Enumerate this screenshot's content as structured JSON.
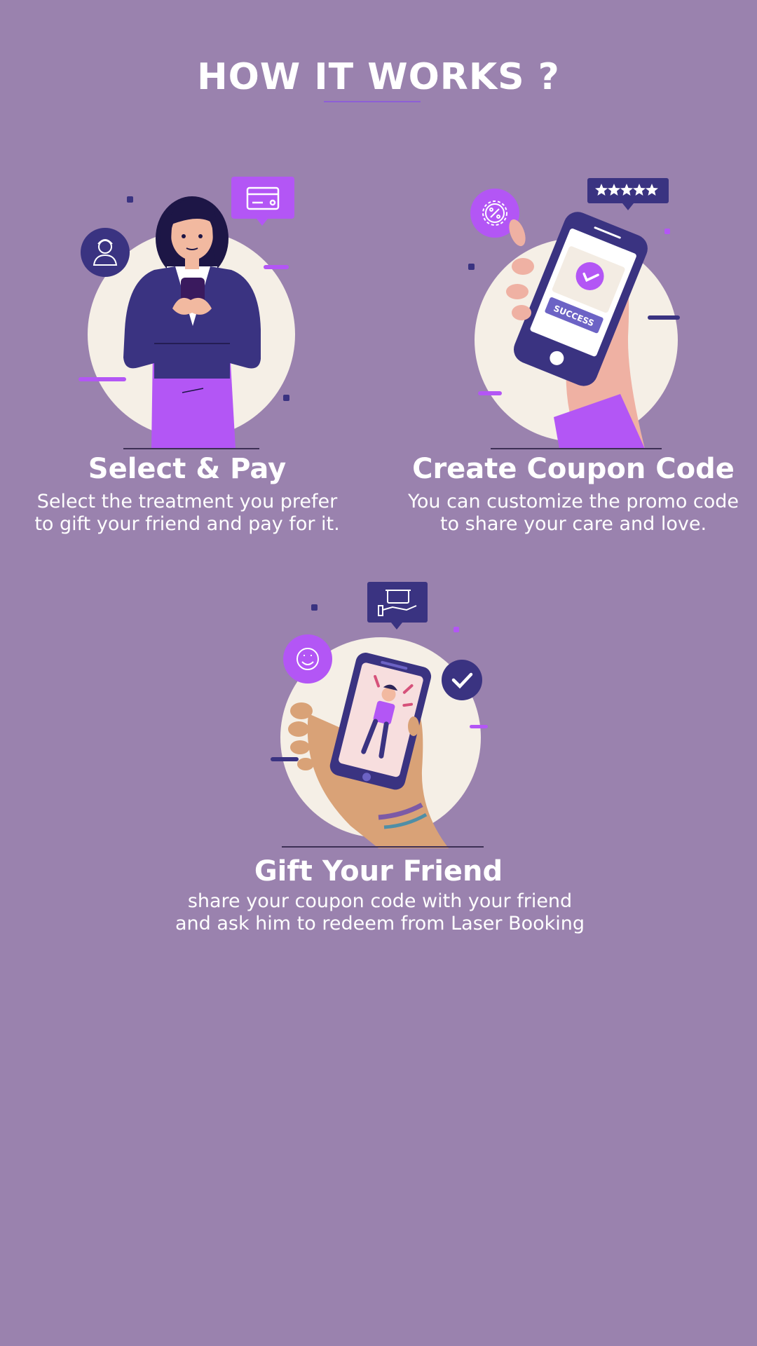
{
  "page": {
    "title": "HOW IT WORKS ?"
  },
  "steps": [
    {
      "title": "Select & Pay",
      "description_lines": [
        "Select the treatment you prefer",
        "to gift your friend and pay for it."
      ]
    },
    {
      "title": "Create Coupon Code",
      "description_lines": [
        "You can customize the promo code",
        "to share your care and love."
      ],
      "badge_text": "SUCCESS"
    },
    {
      "title": "Gift Your Friend",
      "description_lines": [
        "share your coupon code with your friend",
        "and ask him to redeem from Laser Booking"
      ]
    }
  ],
  "colors": {
    "background": "#9a82ae",
    "accent_purple": "#b356f5",
    "navy": "#3a3381",
    "cream": "#f5efe6",
    "text": "#ffffff"
  },
  "icons": {
    "step1": [
      "avatar-icon",
      "credit-card-icon"
    ],
    "step2": [
      "discount-gear-icon",
      "five-star-rating-icon",
      "checkmark-icon"
    ],
    "step3": [
      "smiley-icon",
      "gift-hand-icon",
      "check-circle-icon"
    ]
  }
}
